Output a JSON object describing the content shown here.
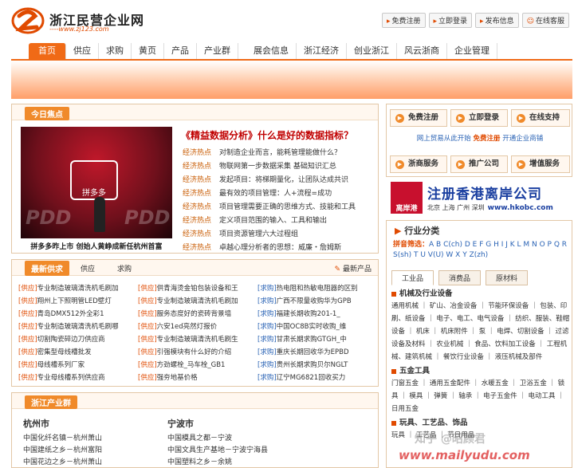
{
  "site": {
    "title": "浙江民营企业网",
    "url": "----www.zj123.com"
  },
  "top_links": [
    {
      "label": "免费注册"
    },
    {
      "label": "立即登录"
    },
    {
      "label": "发布信息"
    },
    {
      "label": "在线客服"
    }
  ],
  "nav": [
    "首页",
    "供应",
    "求购",
    "黄页",
    "产品",
    "产业群",
    "展会信息",
    "浙江经济",
    "创业浙江",
    "风云浙商",
    "企业管理"
  ],
  "focus": {
    "title": "今日焦点",
    "caption": "拼多多昨上市 创始人黄峥成新任杭州首富",
    "photo_text": "拼多多",
    "photo_brand": "PDD",
    "headline": "《精益数据分析》什么是好的数据指标？",
    "items": [
      {
        "cat": "经济热点",
        "text": "对制造企业而言，能耗管理能做什么？"
      },
      {
        "cat": "经济热点",
        "text": "物联网第一步数据采集 基础知识汇总"
      },
      {
        "cat": "经济热点",
        "text": "发起项目：将梯期量化，让团队达成共识"
      },
      {
        "cat": "经济热点",
        "text": "最有效的项目管理：人+流程=成功"
      },
      {
        "cat": "经济热点",
        "text": "项目管理需要正确的思维方式、技能和工具"
      },
      {
        "cat": "经济热点",
        "text": "定义项目范围的输入、工具和输出"
      },
      {
        "cat": "经济热点",
        "text": "项目资源管理六大过程组"
      },
      {
        "cat": "经济热点",
        "text": "卓越心理分析者的思想：威廉・詹姆斯"
      }
    ]
  },
  "supply": {
    "tabs": [
      "最新供求",
      "供应",
      "求购"
    ],
    "more": "最新产品",
    "columns": [
      [
        {
          "tag": "[供应]",
          "type": "supply",
          "text": "专业制造玻璃清洗机毛刷加"
        },
        {
          "tag": "[供应]",
          "type": "supply",
          "text": "翔州上下照明管LED壁灯"
        },
        {
          "tag": "[供应]",
          "type": "supply",
          "text": "青岛DMX512外全彩1"
        },
        {
          "tag": "[供应]",
          "type": "supply",
          "text": "专业制造玻璃清洗机毛刷哪"
        },
        {
          "tag": "[供应]",
          "type": "supply",
          "text": "切割陶瓷碎边刀供应商"
        },
        {
          "tag": "[供应]",
          "type": "supply",
          "text": "密集型母线槽批发"
        },
        {
          "tag": "[供应]",
          "type": "supply",
          "text": "母线槽系列厂家"
        },
        {
          "tag": "[供应]",
          "type": "supply",
          "text": "专业母线槽系列供应商"
        }
      ],
      [
        {
          "tag": "[供应]",
          "type": "supply",
          "text": "供青海烫金铂包装设备和王"
        },
        {
          "tag": "[供应]",
          "type": "supply",
          "text": "专业制造玻璃清洗机毛刷加"
        },
        {
          "tag": "[供应]",
          "type": "supply",
          "text": "服务态度好的瓷砖背景墙"
        },
        {
          "tag": "[供应]",
          "type": "supply",
          "text": "六安1ed亮然灯报价"
        },
        {
          "tag": "[供应]",
          "type": "supply",
          "text": "专业制造玻璃清洗机毛刷生"
        },
        {
          "tag": "[供应]",
          "type": "supply",
          "text": "引强模块有什么好的介绍"
        },
        {
          "tag": "[供应]",
          "type": "supply",
          "text": "方劲螺栓_马车栓_GB1"
        },
        {
          "tag": "[供应]",
          "type": "supply",
          "text": "强夯地基价格"
        }
      ],
      [
        {
          "tag": "[求购]",
          "type": "buy",
          "text": "热电阻和热敏电阻器的区别"
        },
        {
          "tag": "[求购]",
          "type": "buy",
          "text": "广西不限量收购华为GPB"
        },
        {
          "tag": "[求购]",
          "type": "buy",
          "text": "福建长期收购201-1_"
        },
        {
          "tag": "[求购]",
          "type": "buy",
          "text": "中国OC8B实时收购_维"
        },
        {
          "tag": "[求购]",
          "type": "buy",
          "text": "甘肃长期求购GTGH_中"
        },
        {
          "tag": "[求购]",
          "type": "buy",
          "text": "重庆长期回收华为EPBD"
        },
        {
          "tag": "[求购]",
          "type": "buy",
          "text": "贵州长期求购贝尔NGLT"
        },
        {
          "tag": "[求购]",
          "type": "buy",
          "text": "辽宁MG6821回收买力"
        }
      ]
    ]
  },
  "cluster": {
    "title": "浙江产业群",
    "cities": [
      {
        "name": "杭州市",
        "items": [
          "中国化纤名镇－杭州萧山",
          "中国建纸之乡－杭州富阳",
          "中国花边之乡－杭州萧山"
        ]
      },
      {
        "name": "宁波市",
        "items": [
          "中国模具之都－宁波",
          "中国文具生产基地－宁波宁海县",
          "中国塑料之乡－余姚"
        ]
      }
    ]
  },
  "member": {
    "buttons": [
      "免费注册",
      "立即登录",
      "在线支持",
      "浙商服务",
      "推广公司",
      "增值服务"
    ],
    "tip_prefix": "网上贸易从此开始",
    "tip_em": "免费注册",
    "tip_suffix": "开通企业商铺"
  },
  "hk_ad": {
    "logo": "离岸港",
    "main": "注册香港离岸公司",
    "sub": "北京 上海 广州 深圳",
    "url": "www.hkobc.com"
  },
  "categories": {
    "title": "行业分类",
    "pinyin_label": "拼音筛选：",
    "pinyin": "A B C(ch) D E F G H I J K L M N O P Q R S(sh) T U V(U) W X Y Z(zh)",
    "tabs": [
      "工业品",
      "消费品",
      "原材料"
    ],
    "groups": [
      {
        "name": "机械及行业设备",
        "items": "通用机械 ｜ 矿山、冶金设备 ｜ 节能环保设备 ｜ 包装、印刷、纸设备 ｜ 电子、电工、电气设备 ｜ 纺织、服装、鞋帽设备 ｜ 机床 ｜ 机床附件 ｜ 泵 ｜ 电焊、切割设备 ｜ 过滤设备及材料 ｜ 农业机械 ｜ 食品、饮料加工设备 ｜ 工程机械、建筑机械 ｜ 餐饮行业设备 ｜ 液压机械及部件"
      },
      {
        "name": "五金工具",
        "items": "门窗五金 ｜ 通用五金配件 ｜ 水暖五金 ｜ 卫浴五金 ｜ 锁具 ｜ 模具 ｜ 弹簧 ｜ 轴承 ｜ 电子五金件 ｜ 电动工具 ｜ 日用五金"
      },
      {
        "name": "玩具、工艺品、饰品",
        "items": "玩具 ｜ 工艺品 ｜ 节日用品"
      }
    ]
  },
  "watermark": {
    "zhihu": "知乎 @昭顾君",
    "site": "www.mailyudu.com"
  },
  "colors": {
    "accent": "#f06a16",
    "link_blue": "#2a63b5",
    "headline_red": "#c00000"
  }
}
